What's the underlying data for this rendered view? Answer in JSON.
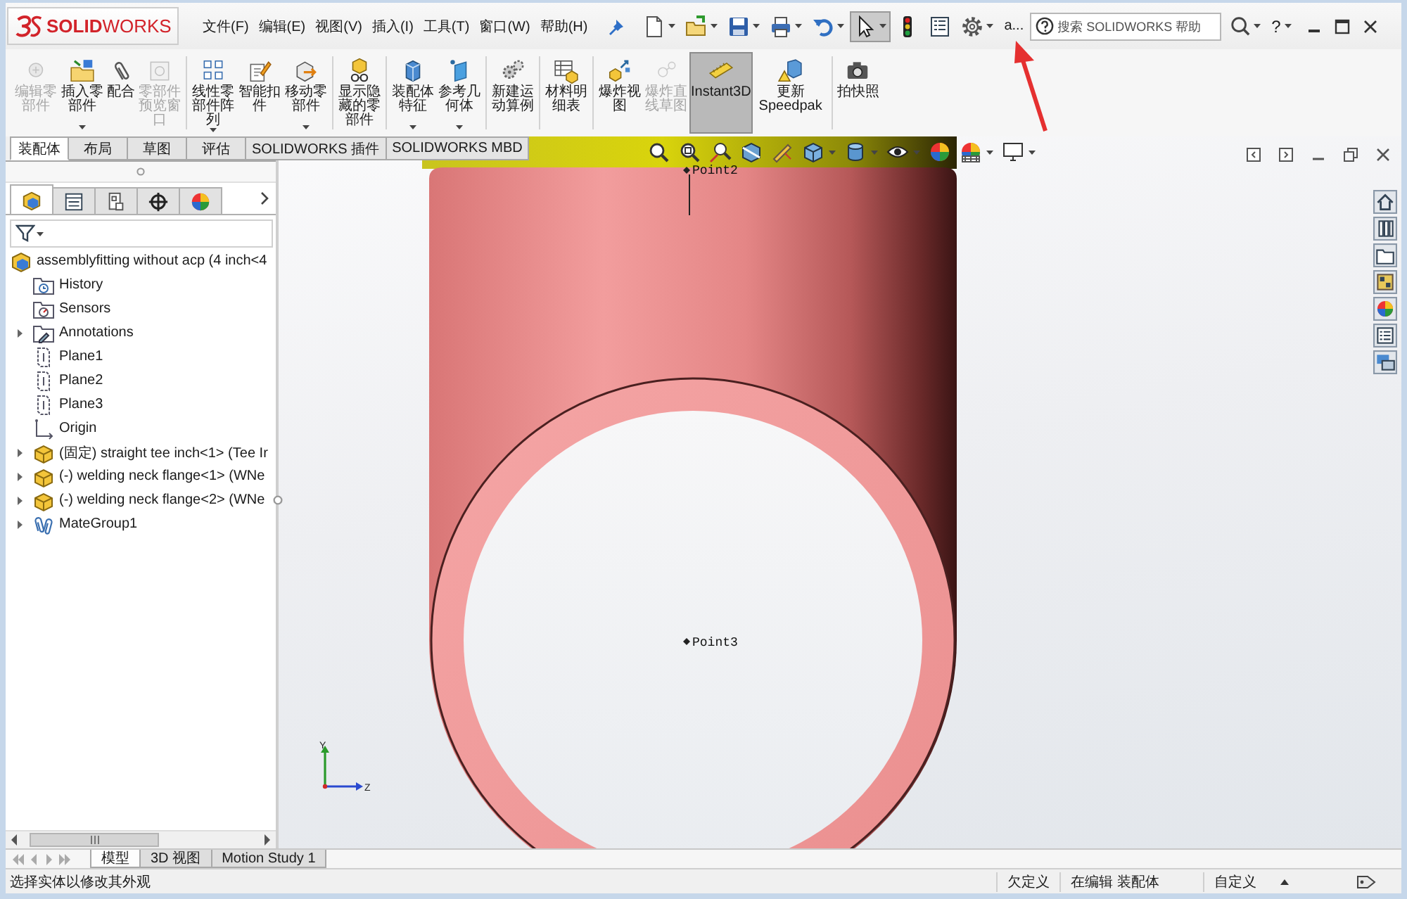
{
  "window": {
    "logo": "**SOLID**WORKS",
    "menu": [
      "文件(F)",
      "编辑(E)",
      "视图(V)",
      "插入(I)",
      "工具(T)",
      "窗口(W)",
      "帮助(H)"
    ],
    "quick_access": [
      {
        "kind": "new",
        "dropdown": true,
        "selected": false
      },
      {
        "kind": "open",
        "dropdown": true,
        "selected": false
      },
      {
        "kind": "save",
        "dropdown": true,
        "selected": false
      },
      {
        "kind": "print",
        "dropdown": true,
        "selected": false
      },
      {
        "kind": "undo",
        "dropdown": true,
        "selected": false
      },
      {
        "kind": "select",
        "dropdown": true,
        "selected": true
      },
      {
        "kind": "rebuild",
        "dropdown": false,
        "selected": false
      },
      {
        "kind": "properties",
        "dropdown": false,
        "selected": false
      },
      {
        "kind": "options",
        "dropdown": true,
        "selected": false
      }
    ],
    "doc_title": "a...",
    "search": {
      "placeholder": "搜索 SOLIDWORKS 帮助"
    },
    "help_label": "?"
  },
  "command_manager": {
    "groups": [
      {
        "items": [
          {
            "label": "编辑零部件",
            "kind": "edit-part",
            "disabled": true,
            "selected": false,
            "dropdown": false
          },
          {
            "label": "插入零部件",
            "kind": "insert-part",
            "disabled": false,
            "selected": false,
            "dropdown": true
          },
          {
            "label": "配合",
            "kind": "mate",
            "disabled": false,
            "selected": false,
            "dropdown": false
          },
          {
            "label": "零部件预览窗口",
            "kind": "preview",
            "disabled": true,
            "selected": false,
            "dropdown": false
          }
        ]
      },
      {
        "items": [
          {
            "label": "线性零部件阵列",
            "kind": "linear-pattern",
            "disabled": false,
            "selected": false,
            "dropdown": true
          },
          {
            "label": "智能扣件",
            "kind": "smart-fasteners",
            "disabled": false,
            "selected": false,
            "dropdown": false
          },
          {
            "label": "移动零部件",
            "kind": "move-component",
            "disabled": false,
            "selected": false,
            "dropdown": true
          }
        ]
      },
      {
        "items": [
          {
            "label": "显示隐藏的零部件",
            "kind": "show-hidden",
            "disabled": false,
            "selected": false,
            "dropdown": false
          }
        ]
      },
      {
        "items": [
          {
            "label": "装配体特征",
            "kind": "assembly-features",
            "disabled": false,
            "selected": false,
            "dropdown": true
          },
          {
            "label": "参考几何体",
            "kind": "reference-geometry",
            "disabled": false,
            "selected": false,
            "dropdown": true
          }
        ]
      },
      {
        "items": [
          {
            "label": "新建运动算例",
            "kind": "motion-study",
            "disabled": false,
            "selected": false,
            "dropdown": false
          }
        ]
      },
      {
        "items": [
          {
            "label": "材料明细表",
            "kind": "bom",
            "disabled": false,
            "selected": false,
            "dropdown": false
          }
        ]
      },
      {
        "items": [
          {
            "label": "爆炸视图",
            "kind": "exploded-view",
            "disabled": false,
            "selected": false,
            "dropdown": false
          },
          {
            "label": "爆炸直线草图",
            "kind": "explode-line",
            "disabled": true,
            "selected": false,
            "dropdown": false
          },
          {
            "label": "Instant3D",
            "kind": "instant3d",
            "disabled": false,
            "selected": true,
            "dropdown": false
          },
          {
            "label": "更新Speedpak",
            "kind": "speedpak",
            "disabled": false,
            "selected": false,
            "dropdown": false
          }
        ]
      },
      {
        "items": [
          {
            "label": "拍快照",
            "kind": "snapshot",
            "disabled": false,
            "selected": false,
            "dropdown": false
          }
        ]
      }
    ],
    "tabs": [
      {
        "label": "装配体",
        "selected": true
      },
      {
        "label": "布局",
        "selected": false
      },
      {
        "label": "草图",
        "selected": false
      },
      {
        "label": "评估",
        "selected": false
      },
      {
        "label": "SOLIDWORKS 插件",
        "selected": false
      },
      {
        "label": "SOLIDWORKS MBD",
        "selected": false
      }
    ]
  },
  "feature_manager": {
    "panel_tabs": [
      {
        "kind": "feature-tree",
        "selected": true
      },
      {
        "kind": "property-manager",
        "selected": false
      },
      {
        "kind": "configuration-manager",
        "selected": false
      },
      {
        "kind": "dimxpert",
        "selected": false
      },
      {
        "kind": "display-manager",
        "selected": false
      }
    ],
    "tree": {
      "label": "assemblyfitting without acp (4 inch<4",
      "kind": "assembly",
      "children": [
        {
          "label": "History",
          "kind": "history"
        },
        {
          "label": "Sensors",
          "kind": "sensors"
        },
        {
          "label": "Annotations",
          "kind": "annotations",
          "expanded": false
        },
        {
          "label": "Plane1",
          "kind": "plane"
        },
        {
          "label": "Plane2",
          "kind": "plane"
        },
        {
          "label": "Plane3",
          "kind": "plane"
        },
        {
          "label": "Origin",
          "kind": "origin"
        },
        {
          "label": "(固定) straight tee inch<1> (Tee Ir",
          "kind": "part",
          "expanded": false
        },
        {
          "label": "(-) welding neck flange<1> (WNe",
          "kind": "part",
          "expanded": false
        },
        {
          "label": "(-) welding neck flange<2> (WNe",
          "kind": "part",
          "expanded": false
        },
        {
          "label": "MateGroup1",
          "kind": "mates",
          "expanded": false
        }
      ]
    }
  },
  "viewport": {
    "heads_up_toolbar": [
      {
        "kind": "zoom-fit",
        "dropdown": false
      },
      {
        "kind": "zoom-area",
        "dropdown": false
      },
      {
        "kind": "previous-view",
        "dropdown": false
      },
      {
        "kind": "section-view",
        "dropdown": false
      },
      {
        "kind": "dynamic-annotation",
        "dropdown": false
      },
      {
        "kind": "view-orientation",
        "dropdown": true
      },
      {
        "kind": "display-style",
        "dropdown": true
      },
      {
        "kind": "hide-show",
        "dropdown": true
      },
      {
        "kind": "edit-appearance",
        "dropdown": false
      },
      {
        "kind": "apply-scene",
        "dropdown": true
      },
      {
        "kind": "view-settings",
        "dropdown": true
      }
    ],
    "points": [
      "Point2",
      "Point3"
    ],
    "triad_labels": [
      "Y",
      "Z"
    ]
  },
  "task_pane": [
    {
      "kind": "home"
    },
    {
      "kind": "design-library"
    },
    {
      "kind": "file-explorer"
    },
    {
      "kind": "view-palette"
    },
    {
      "kind": "appearances"
    },
    {
      "kind": "custom-properties"
    },
    {
      "kind": "forum"
    }
  ],
  "bottom_tabs": [
    {
      "label": "模型",
      "selected": true
    },
    {
      "label": "3D 视图",
      "selected": false
    },
    {
      "label": "Motion Study 1",
      "selected": false
    }
  ],
  "status_bar": {
    "message": "选择实体以修改其外观",
    "fields": [
      "欠定义",
      "在编辑 装配体",
      "自定义"
    ]
  }
}
